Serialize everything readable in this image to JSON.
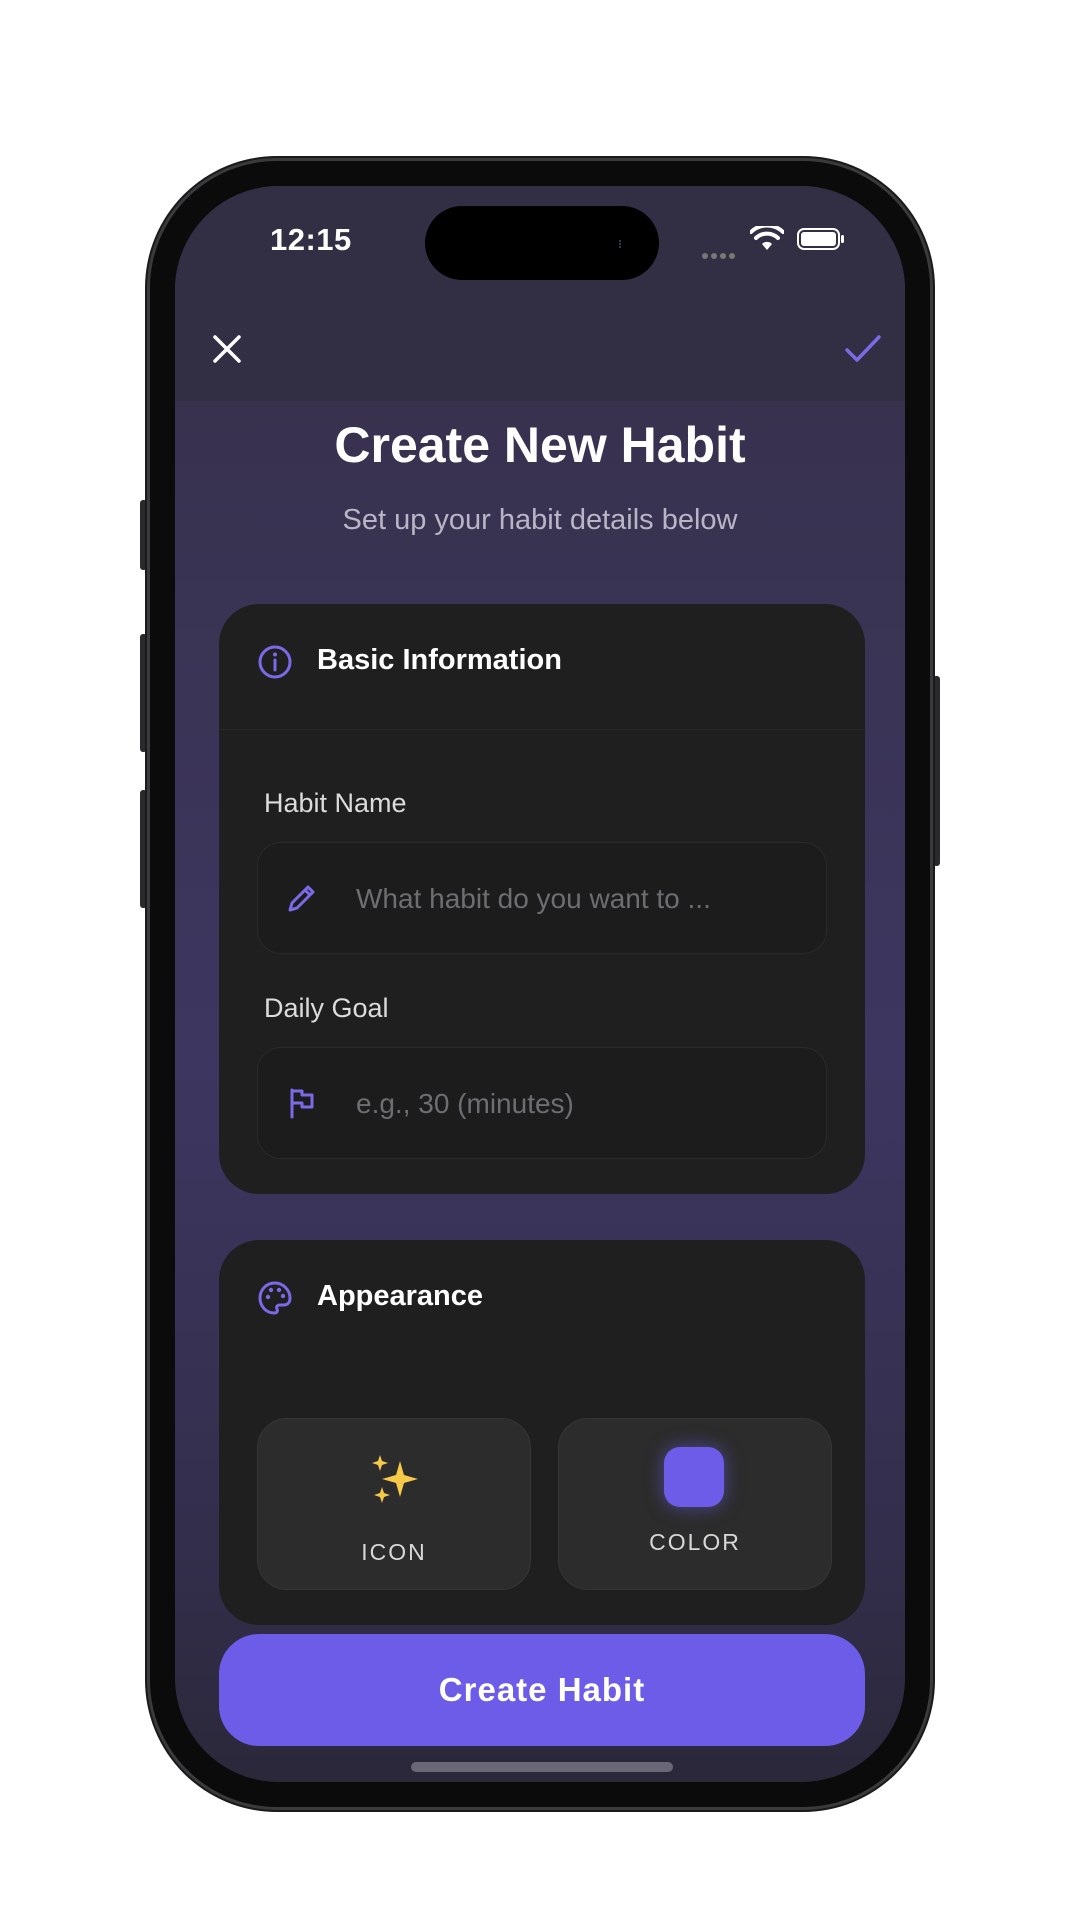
{
  "status_bar": {
    "time": "12:15"
  },
  "nav": {
    "close_icon": "x-icon",
    "done_icon": "checkmark-icon"
  },
  "header": {
    "title": "Create New Habit",
    "subtitle": "Set up your habit details below"
  },
  "basic_info": {
    "section_title": "Basic Information",
    "section_icon": "info-circle-icon",
    "habit_name": {
      "label": "Habit Name",
      "placeholder": "What habit do you want to ...",
      "value": "",
      "icon": "pencil-icon"
    },
    "daily_goal": {
      "label": "Daily Goal",
      "placeholder": "e.g., 30 (minutes)",
      "value": "",
      "icon": "flag-icon"
    }
  },
  "appearance": {
    "section_title": "Appearance",
    "section_icon": "palette-icon",
    "icon_tile": {
      "label": "ICON",
      "selected": "sparkles-icon"
    },
    "color_tile": {
      "label": "COLOR",
      "selected_color": "#6c5ce7"
    }
  },
  "actions": {
    "create_label": "Create Habit"
  },
  "theme": {
    "accent": "#6c5ce7",
    "card_bg": "#1f1f1f",
    "screen_bg": "#3d3660"
  }
}
